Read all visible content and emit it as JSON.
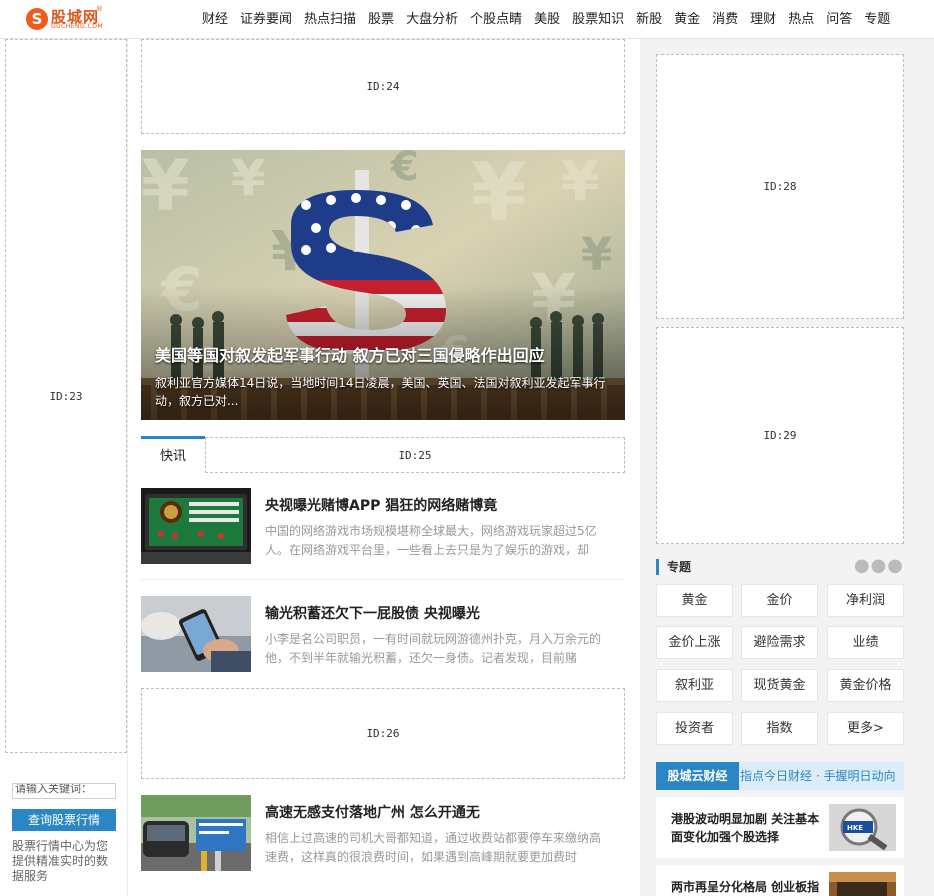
{
  "header": {
    "logo_text": "股城网",
    "logo_sub": "GUCHENG.COM",
    "logo_reg": "®",
    "nav": [
      "财经",
      "证券要闻",
      "热点扫描",
      "股票",
      "大盘分析",
      "个股点睛",
      "美股",
      "股票知识",
      "新股",
      "黄金",
      "消费",
      "理财",
      "热点",
      "问答",
      "专题"
    ]
  },
  "left": {
    "ad_label": "ID:23",
    "query_placeholder": "请输入关键词：",
    "query_button": "查询股票行情",
    "query_desc": "股票行情中心为您提供精准实时的数据服务"
  },
  "main": {
    "ad_top": "ID:24",
    "hero": {
      "title": "美国等国对叙发起军事行动 叙方已对三国侵略作出回应",
      "summary": "叙利亚官方媒体14日说，当地时间14日凌晨，美国、英国、法国对叙利亚发起军事行动，叙方已对..."
    },
    "tab_active": "快讯",
    "ad_tab": "ID:25",
    "articles": [
      {
        "title": "央视曝光赌博APP 猖狂的网络赌博竟",
        "summary": "中国的网络游戏市场规模堪称全球最大，网络游戏玩家超过5亿人。在网络游戏平台里，一些看上去只是为了娱乐的游戏，却"
      },
      {
        "title": "输光积蓄还欠下一屁股债 央视曝光",
        "summary": "小李是名公司职员，一有时间就玩网游德州扑克，月入万余元的他，不到半年就输光积蓄，还欠一身债。记者发现，目前赌"
      },
      {
        "title": "高速无感支付落地广州 怎么开通无",
        "summary": "相信上过高速的司机大哥都知道，通过收费站都要停车来缴纳高速费，这样真的很浪费时间，如果遇到高峰期就要更加费时"
      }
    ],
    "ad_mid": "ID:26"
  },
  "right": {
    "ad_1": "ID:28",
    "ad_2": "ID:29",
    "topics_title": "专题",
    "topics_more": "●●●",
    "tags": [
      "黄金",
      "金价",
      "净利润",
      "金价上涨",
      "避险需求",
      "业绩",
      "叙利亚",
      "现货黄金",
      "黄金价格",
      "投资者",
      "指数",
      "更多>"
    ],
    "cloud_badge": "股城云财经",
    "cloud_slogan": "指点今日财经 · 手握明日动向",
    "news": [
      {
        "title": "港股波动明显加剧 关注基本面变化加强个股选择",
        "thumb_text": "HKE"
      },
      {
        "title": "两市再呈分化格局 创业板指"
      }
    ]
  },
  "colors": {
    "accent": "#2b86c5",
    "brand": "#e4551b"
  }
}
